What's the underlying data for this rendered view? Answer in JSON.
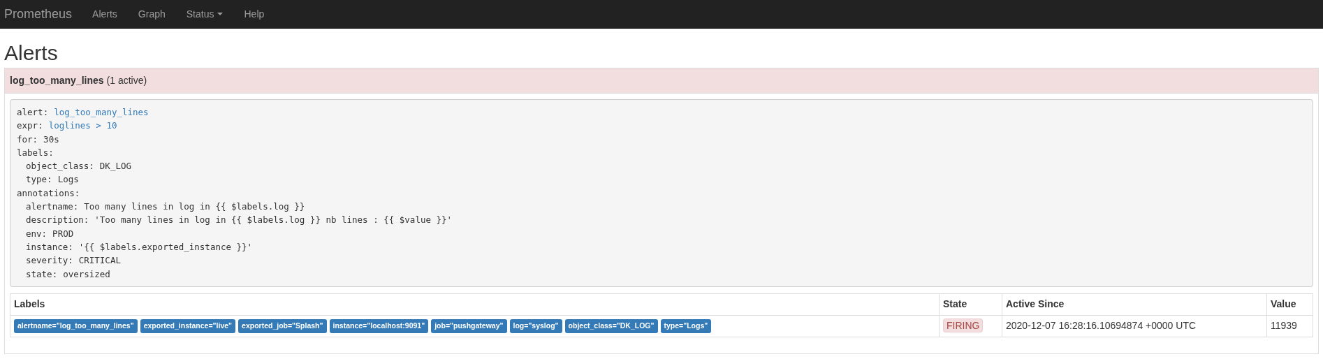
{
  "navbar": {
    "brand": "Prometheus",
    "items": [
      {
        "label": "Alerts",
        "dropdown": false
      },
      {
        "label": "Graph",
        "dropdown": false
      },
      {
        "label": "Status",
        "dropdown": true
      },
      {
        "label": "Help",
        "dropdown": false
      }
    ]
  },
  "page_title": "Alerts",
  "alert_groups": [
    {
      "name": "log_too_many_lines",
      "count": "(1 active)",
      "rule": [
        {
          "key": "alert:",
          "value": "log_too_many_lines",
          "kind": "link"
        },
        {
          "key": "expr:",
          "value": "loglines > 10",
          "kind": "link"
        },
        {
          "key": "for:",
          "value": "30s",
          "kind": "plain"
        },
        {
          "key": "labels:",
          "kind": "section",
          "children": [
            {
              "key": "object_class:",
              "value": "DK_LOG",
              "kind": "plain"
            },
            {
              "key": "type:",
              "value": "Logs",
              "kind": "plain"
            }
          ]
        },
        {
          "key": "annotations:",
          "kind": "section",
          "children": [
            {
              "key": "alertname:",
              "value": "Too many lines in log in {{ $labels.log }}",
              "kind": "plain"
            },
            {
              "key": "description:",
              "value": "'Too many lines in log in {{ $labels.log }} nb lines : {{ $value }}'",
              "kind": "plain"
            },
            {
              "key": "env:",
              "value": "PROD",
              "kind": "plain"
            },
            {
              "key": "instance:",
              "value": "'{{ $labels.exported_instance }}'",
              "kind": "plain"
            },
            {
              "key": "severity:",
              "value": "CRITICAL",
              "kind": "plain"
            },
            {
              "key": "state:",
              "value": "oversized",
              "kind": "plain"
            }
          ]
        }
      ],
      "table": {
        "columns": [
          "Labels",
          "State",
          "Active Since",
          "Value"
        ],
        "rows": [
          {
            "labels": [
              "alertname=\"log_too_many_lines\"",
              "exported_instance=\"live\"",
              "exported_job=\"Splash\"",
              "instance=\"localhost:9091\"",
              "job=\"pushgateway\"",
              "log=\"syslog\"",
              "object_class=\"DK_LOG\"",
              "type=\"Logs\""
            ],
            "state": "FIRING",
            "kind": "firing",
            "active_since": "2020-12-07 16:28:16.10694874 +0000 UTC",
            "value": "11939"
          }
        ]
      }
    }
  ]
}
